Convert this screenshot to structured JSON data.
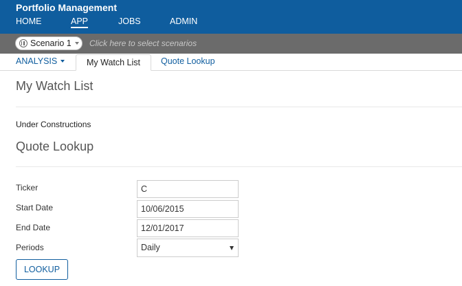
{
  "header": {
    "title": "Portfolio Management",
    "nav": [
      {
        "label": "HOME",
        "active": false
      },
      {
        "label": "APP",
        "active": true
      },
      {
        "label": "JOBS",
        "active": false
      },
      {
        "label": "ADMIN",
        "active": false
      }
    ],
    "background_color": "#0f5d9e"
  },
  "scenario_bar": {
    "selected_scenario": "Scenario 1",
    "hint": "Click here to select scenarios"
  },
  "tabs": [
    {
      "label": "ANALYSIS",
      "has_dropdown": true,
      "active": false
    },
    {
      "label": "My Watch List",
      "active": true
    },
    {
      "label": "Quote Lookup",
      "active": false
    }
  ],
  "watch_list": {
    "heading": "My Watch List",
    "note": "Under Constructions"
  },
  "quote_lookup": {
    "heading": "Quote Lookup",
    "fields": {
      "ticker": {
        "label": "Ticker",
        "value": "C"
      },
      "start_date": {
        "label": "Start Date",
        "value": "10/06/2015"
      },
      "end_date": {
        "label": "End Date",
        "value": "12/01/2017"
      },
      "periods": {
        "label": "Periods",
        "value": "Daily"
      }
    },
    "button_label": "LOOKUP"
  }
}
